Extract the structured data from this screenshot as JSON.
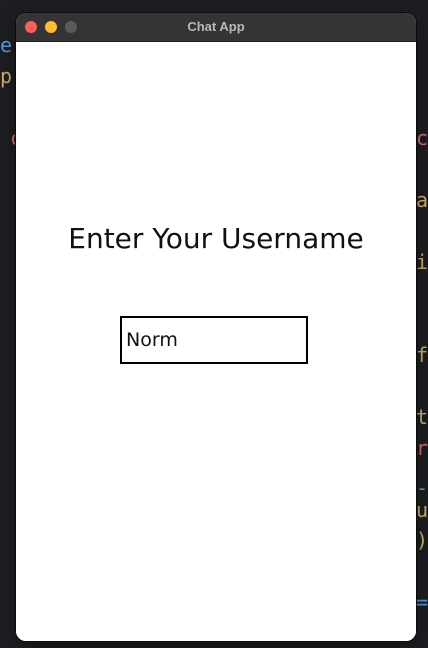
{
  "window": {
    "title": "Chat App"
  },
  "background_code": [
    {
      "text": "e",
      "color": "#5aa0e6"
    },
    {
      "text": "p",
      "color": "#d7b36a"
    },
    {
      "text": "c",
      "color": "#e06c75"
    },
    {
      "text": "c",
      "color": "#e06c75"
    },
    {
      "text": "a",
      "color": "#d7b36a"
    },
    {
      "text": "i",
      "color": "#d7b36a"
    },
    {
      "text": "f",
      "color": "#d7b36a"
    },
    {
      "text": "t",
      "color": "#d7b36a"
    },
    {
      "text": "r",
      "color": "#e06c75"
    },
    {
      "text": "-",
      "color": "#5aa0e6"
    },
    {
      "text": "u",
      "color": "#d7b36a"
    },
    {
      "text": ")",
      "color": "#d7b36a"
    },
    {
      "text": "=",
      "color": "#5aa0e6"
    }
  ],
  "main": {
    "heading": "Enter Your Username",
    "username_input": {
      "value": "Norm"
    }
  }
}
